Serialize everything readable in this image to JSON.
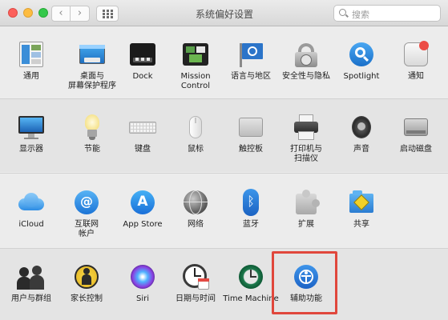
{
  "window": {
    "title": "系统偏好设置"
  },
  "search": {
    "placeholder": "搜索"
  },
  "nav": {
    "back": "‹",
    "forward": "›"
  },
  "rows": [
    [
      {
        "name": "general",
        "label": "通用",
        "label2": ""
      },
      {
        "name": "desktop-screensaver",
        "label": "桌面与",
        "label2": "屏幕保护程序"
      },
      {
        "name": "dock",
        "label": "Dock",
        "label2": ""
      },
      {
        "name": "mission-control",
        "label": "Mission",
        "label2": "Control"
      },
      {
        "name": "language-region",
        "label": "语言与地区",
        "label2": ""
      },
      {
        "name": "security-privacy",
        "label": "安全性与隐私",
        "label2": ""
      },
      {
        "name": "spotlight",
        "label": "Spotlight",
        "label2": ""
      },
      {
        "name": "notifications",
        "label": "通知",
        "label2": ""
      }
    ],
    [
      {
        "name": "displays",
        "label": "显示器",
        "label2": ""
      },
      {
        "name": "energy-saver",
        "label": "节能",
        "label2": ""
      },
      {
        "name": "keyboard",
        "label": "键盘",
        "label2": ""
      },
      {
        "name": "mouse",
        "label": "鼠标",
        "label2": ""
      },
      {
        "name": "trackpad",
        "label": "触控板",
        "label2": ""
      },
      {
        "name": "printers-scanners",
        "label": "打印机与",
        "label2": "扫描仪"
      },
      {
        "name": "sound",
        "label": "声音",
        "label2": ""
      },
      {
        "name": "startup-disk",
        "label": "启动磁盘",
        "label2": ""
      }
    ],
    [
      {
        "name": "icloud",
        "label": "iCloud",
        "label2": ""
      },
      {
        "name": "internet-accounts",
        "label": "互联网",
        "label2": "帐户"
      },
      {
        "name": "app-store",
        "label": "App Store",
        "label2": ""
      },
      {
        "name": "network",
        "label": "网络",
        "label2": ""
      },
      {
        "name": "bluetooth",
        "label": "蓝牙",
        "label2": ""
      },
      {
        "name": "extensions",
        "label": "扩展",
        "label2": ""
      },
      {
        "name": "sharing",
        "label": "共享",
        "label2": ""
      }
    ],
    [
      {
        "name": "users-groups",
        "label": "用户与群组",
        "label2": ""
      },
      {
        "name": "parental-controls",
        "label": "家长控制",
        "label2": ""
      },
      {
        "name": "siri",
        "label": "Siri",
        "label2": ""
      },
      {
        "name": "date-time",
        "label": "日期与时间",
        "label2": ""
      },
      {
        "name": "time-machine",
        "label": "Time Machine",
        "label2": ""
      },
      {
        "name": "accessibility",
        "label": "辅助功能",
        "label2": ""
      }
    ]
  ],
  "highlight_color": "#e0473c"
}
